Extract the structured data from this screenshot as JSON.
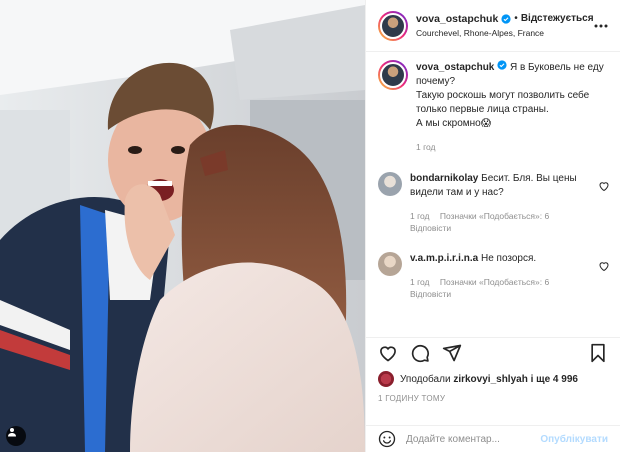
{
  "header": {
    "username": "vova_ostapchuk",
    "separator": "•",
    "follow_state": "Відстежується",
    "location": "Courchevel, Rhone-Alpes, France"
  },
  "caption": {
    "username": "vova_ostapchuk",
    "lines": [
      "Я в Буковель не еду почему?",
      "Такую роскошь могут позволить себе только первые лица страны.",
      "А мы скромно😱"
    ],
    "time": "1 год"
  },
  "comments": [
    {
      "username": "bondarnikolay",
      "text": "Бесит. Бля. Вы цены видели там и у нас?",
      "time": "1 год",
      "likes": "Позначки «Подобається»: 6",
      "reply": "Відповісти"
    },
    {
      "username": "v.a.m.p.i.r.i.n.a",
      "text": "Не позорся.",
      "time": "1 год",
      "likes": "Позначки «Подобається»: 6",
      "reply": "Відповісти"
    }
  ],
  "likes": {
    "prefix": "Уподобали",
    "user": "zirkovyi_shlyah",
    "suffix": "і ще 4 996"
  },
  "time_ago": "1 ГОДИНУ ТОМУ",
  "add_comment": {
    "placeholder": "Додайте коментар...",
    "publish": "Опублікувати"
  },
  "icons": {
    "verified": "verified-badge-icon",
    "more": "more-dots-icon",
    "like": "heart-icon",
    "comment": "comment-bubble-icon",
    "share": "paper-plane-icon",
    "save": "bookmark-icon",
    "emoji": "smiley-icon",
    "user_tag": "user-tag-icon"
  },
  "colors": {
    "accent_blue": "#0095f6",
    "publish_disabled": "#b3dbff",
    "muted_text": "#8e8e8e"
  }
}
